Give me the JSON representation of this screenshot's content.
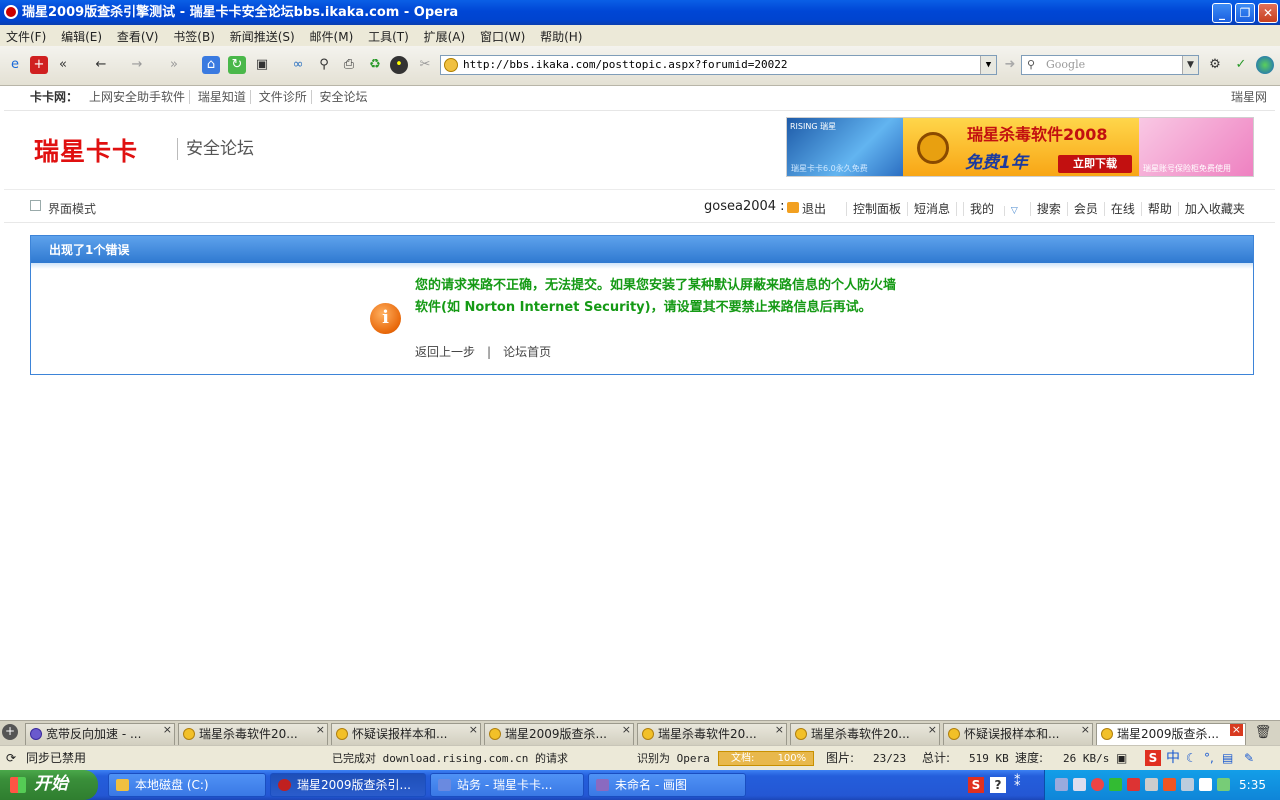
{
  "window": {
    "title": "瑞星2009版查杀引擎测试 - 瑞星卡卡安全论坛bbs.ikaka.com - Opera"
  },
  "menu": [
    "文件(F)",
    "编辑(E)",
    "查看(V)",
    "书签(B)",
    "新闻推送(S)",
    "邮件(M)",
    "工具(T)",
    "扩展(A)",
    "窗口(W)",
    "帮助(H)"
  ],
  "toolbar": {
    "address": "http://bbs.ikaka.com/posttopic.aspx?forumid=20022",
    "search_placeholder": "Google"
  },
  "page": {
    "topnav": {
      "label": "卡卡网：",
      "links": [
        "上网安全助手软件",
        "瑞星知道",
        "文件诊所",
        "安全论坛"
      ],
      "right": "瑞星网"
    },
    "logo": {
      "brand": "瑞星卡卡",
      "sub": "安全论坛"
    },
    "banner": {
      "left_brand": "RISING 瑞星",
      "left_text": "瑞星卡卡6.0永久免费",
      "mid_title": "瑞星杀毒软件2008",
      "mid_sub": "免费1年",
      "mid_button": "立即下载",
      "right_text": "瑞星账号保险柜免费使用"
    },
    "bar": {
      "interface_mode": "界面模式",
      "username": "gosea2004 :",
      "links": [
        "退出",
        "控制面板",
        "短消息",
        "我的",
        "搜索",
        "会员",
        "在线",
        "帮助",
        "加入收藏夹"
      ]
    },
    "error": {
      "header": "出现了1个错误",
      "message": "您的请求来路不正确，无法提交。如果您安装了某种默认屏蔽来路信息的个人防火墙软件(如 Norton Internet Security)，请设置其不要禁止来路信息后再试。",
      "back": "返回上一步",
      "separator": "|",
      "home": "论坛首页"
    }
  },
  "tabs": [
    {
      "label": "宽带反向加速 - ..."
    },
    {
      "label": "瑞星杀毒软件20..."
    },
    {
      "label": "怀疑误报样本和..."
    },
    {
      "label": "瑞星2009版查杀..."
    },
    {
      "label": "瑞星杀毒软件20..."
    },
    {
      "label": "瑞星杀毒软件20..."
    },
    {
      "label": "怀疑误报样本和..."
    },
    {
      "label": "瑞星2009版查杀..."
    }
  ],
  "status": {
    "sync": "同步已禁用",
    "loaded": "已完成对 download.rising.com.cn 的请求",
    "ident": "识别为 Opera",
    "zoom_label": "文档:",
    "zoom_value": "100%",
    "images_label": "图片:",
    "images_value": "23/23",
    "total_label": "总计:",
    "total_value": "519 KB",
    "speed_label": "速度:",
    "speed_value": "26 KB/s"
  },
  "taskbar": {
    "start": "开始",
    "items": [
      "本地磁盘 (C:)",
      "瑞星2009版查杀引...",
      "站务 - 瑞星卡卡...",
      "未命名 - 画图"
    ],
    "clock": "5:35"
  }
}
